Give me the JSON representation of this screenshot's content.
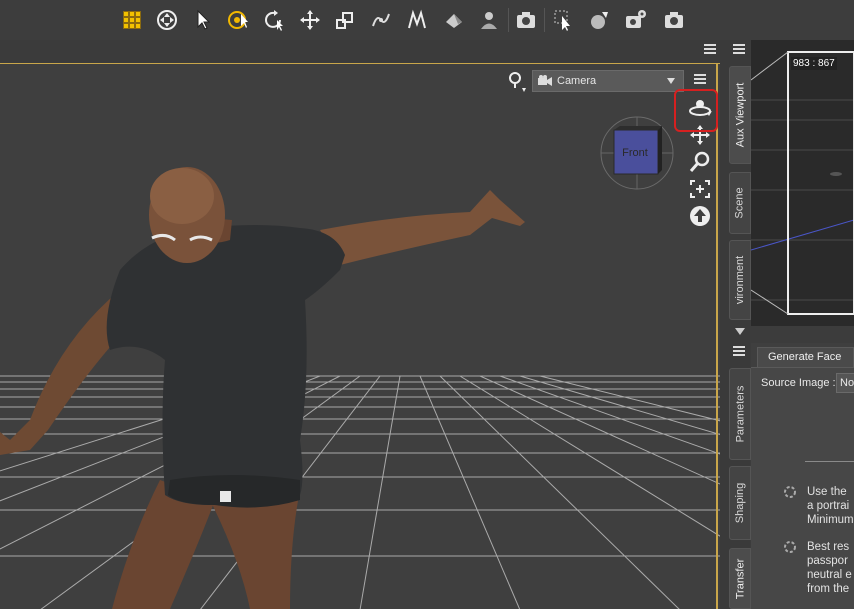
{
  "toolbar": {
    "icons": [
      "grid-tool-icon",
      "universal-tool-icon",
      "pointer-tool-icon",
      "active-pose-icon",
      "rotate-tool-icon",
      "translate-tool-icon",
      "scale-tool-icon",
      "joint-editor-icon",
      "node-weight-icon",
      "geometry-editor-icon",
      "surface-selection-icon",
      "render-icon",
      "spot-render-icon",
      "iray-icon",
      "render-settings-icon",
      "screenshot-icon"
    ]
  },
  "viewport": {
    "camera_label": "Camera",
    "cube_label": "Front",
    "highlight_color": "#d62020",
    "border_color": "#c9a64a"
  },
  "side_tabs": {
    "aux_viewport": "Aux Viewport",
    "scene": "Scene",
    "environment": "vironment",
    "parameters": "Parameters",
    "shaping": "Shaping",
    "transfer": "Transfer"
  },
  "aux": {
    "resolution": "983 : 867"
  },
  "generate_face": {
    "tab_label": "Generate Face",
    "source_label": "Source Image :",
    "source_value": "No",
    "tip1": [
      "Use the",
      "a portrai",
      "Minimum"
    ],
    "tip2": [
      "Best res",
      "passpor",
      "neutral e",
      "from the"
    ]
  }
}
